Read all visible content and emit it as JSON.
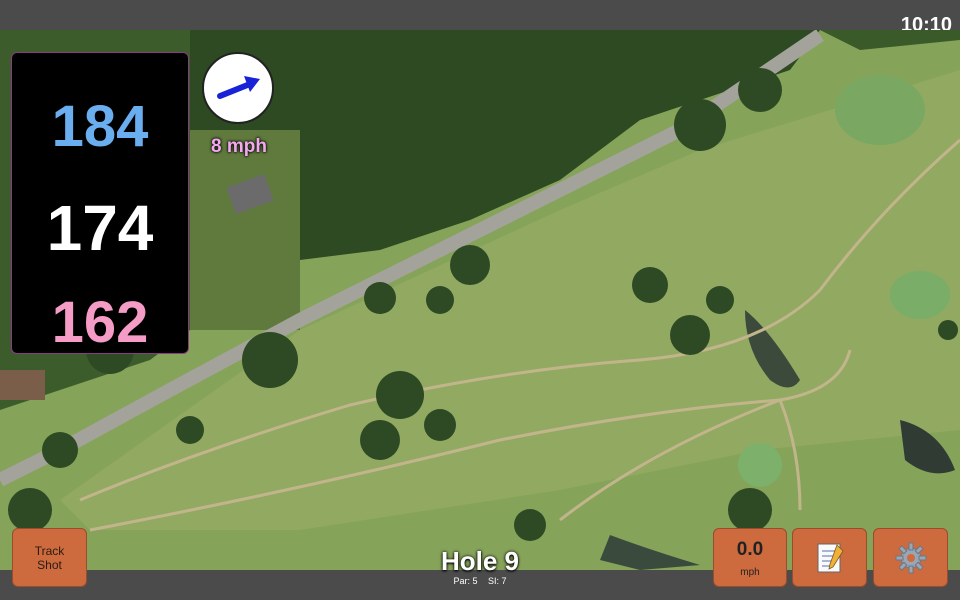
{
  "status": {
    "time": "10:10"
  },
  "distances": {
    "back": "184",
    "center": "174",
    "front": "162"
  },
  "wind": {
    "speed_label": "8 mph",
    "icon": "wind-arrow-icon"
  },
  "track_shot": {
    "label_line1": "Track",
    "label_line2": "Shot"
  },
  "hole": {
    "title": "Hole 9",
    "par_label": "Par: 5",
    "si_label": "SI: 7"
  },
  "speed": {
    "value": "0.0",
    "unit": "mph"
  },
  "icons": {
    "notes": "notepad-icon",
    "settings": "gear-icon"
  },
  "colors": {
    "back_distance": "#6aaef0",
    "center_distance": "#ffffff",
    "front_distance": "#f49bc6",
    "button": "#cd6b3f",
    "wind_label": "#f3a8f0"
  }
}
